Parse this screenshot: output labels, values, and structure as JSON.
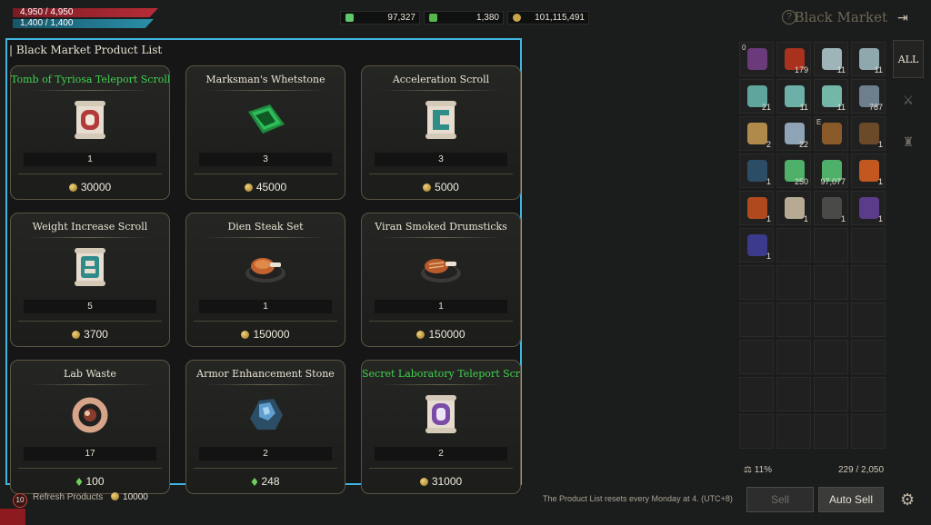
{
  "status": {
    "hp": "4,950 / 4,950",
    "mp": "1,400 / 1,400"
  },
  "currencies": [
    {
      "name": "green-gem",
      "value": "97,327",
      "color": "#5fc76b"
    },
    {
      "name": "green-crystal",
      "value": "1,380",
      "color": "#55b84a"
    },
    {
      "name": "gold-coin",
      "value": "101,115,491",
      "color": "#c9a54c"
    }
  ],
  "header": {
    "title": "Black Market",
    "help_icon": "?",
    "exit_icon": "⇥"
  },
  "panel": {
    "title": "Black Market Product List"
  },
  "products": [
    {
      "name": "Tomb of Tyriosa Teleport Scroll",
      "qty": "1",
      "price": "30000",
      "currency": "coin",
      "green": true,
      "icon": "scroll-red"
    },
    {
      "name": "Marksman's Whetstone",
      "qty": "3",
      "price": "45000",
      "currency": "coin",
      "green": false,
      "icon": "whetstone"
    },
    {
      "name": "Acceleration Scroll",
      "qty": "3",
      "price": "5000",
      "currency": "coin",
      "green": false,
      "icon": "scroll-teal"
    },
    {
      "name": "Weight Increase Scroll",
      "qty": "5",
      "price": "3700",
      "currency": "coin",
      "green": false,
      "icon": "scroll-teal2"
    },
    {
      "name": "Dien Steak Set",
      "qty": "1",
      "price": "150000",
      "currency": "coin",
      "green": false,
      "icon": "steak"
    },
    {
      "name": "Viran Smoked Drumsticks",
      "qty": "1",
      "price": "150000",
      "currency": "coin",
      "green": false,
      "icon": "drumstick"
    },
    {
      "name": "Lab Waste",
      "qty": "17",
      "price": "100",
      "currency": "gem",
      "green": false,
      "icon": "waste"
    },
    {
      "name": "Armor Enhancement Stone",
      "qty": "2",
      "price": "248",
      "currency": "gem",
      "green": false,
      "icon": "stone"
    },
    {
      "name": "Secret Laboratory Teleport Scro",
      "qty": "2",
      "price": "31000",
      "currency": "coin",
      "green": true,
      "icon": "scroll-purple"
    }
  ],
  "inventory": {
    "tabs": [
      "ALL",
      "⚔",
      "♜"
    ],
    "slots": [
      {
        "q": "",
        "corner": "0",
        "color": "#6a3a7a"
      },
      {
        "q": "179",
        "corner": "",
        "color": "#a8321e"
      },
      {
        "q": "11",
        "corner": "",
        "color": "#9fb4b8"
      },
      {
        "q": "11",
        "corner": "",
        "color": "#8fa8ad"
      },
      {
        "q": "21",
        "corner": "",
        "color": "#5fa59d"
      },
      {
        "q": "11",
        "corner": "",
        "color": "#6cb0a8"
      },
      {
        "q": "11",
        "corner": "",
        "color": "#74b7a9"
      },
      {
        "q": "787",
        "corner": "",
        "color": "#6d7f8c"
      },
      {
        "q": "2",
        "corner": "",
        "color": "#b08a4a"
      },
      {
        "q": "22",
        "corner": "",
        "color": "#8ea3b5"
      },
      {
        "q": "",
        "corner": "E",
        "color": "#8b5a2b"
      },
      {
        "q": "1",
        "corner": "",
        "color": "#6b4a2a"
      },
      {
        "q": "1",
        "corner": "",
        "color": "#2c4d66"
      },
      {
        "q": "250",
        "corner": "",
        "color": "#4fb06a"
      },
      {
        "q": "97,077",
        "corner": "",
        "color": "#4fb06a"
      },
      {
        "q": "1",
        "corner": "",
        "color": "#c2571f"
      },
      {
        "q": "1",
        "corner": "",
        "color": "#b04a1e"
      },
      {
        "q": "1",
        "corner": "",
        "color": "#b7aa95"
      },
      {
        "q": "1",
        "corner": "",
        "color": "#4a4a48"
      },
      {
        "q": "1",
        "corner": "",
        "color": "#5a3c8a"
      },
      {
        "q": "1",
        "corner": "",
        "color": "#3c3a8a"
      }
    ],
    "weight": "11%",
    "capacity": "229 / 2,050"
  },
  "buttons": {
    "sell": "Sell",
    "auto_sell": "Auto Sell"
  },
  "footer": {
    "refresh_badge": "10",
    "refresh_label": "Refresh Products",
    "refresh_cost": "10000",
    "reset_note": "The Product List resets every Monday at 4. (UTC+8)"
  }
}
